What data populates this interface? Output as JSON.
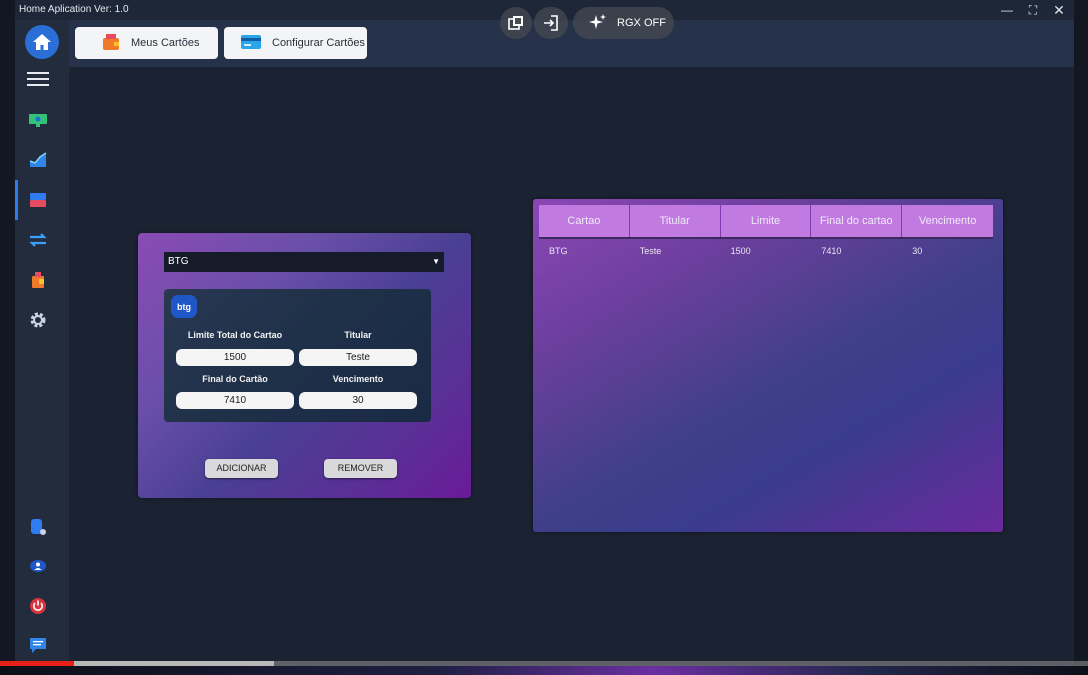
{
  "window": {
    "title": "Home Aplication Ver: 1.0",
    "minimize_icon": "minimize-icon",
    "maximize_icon": "maximize-icon",
    "close_icon": "close-icon"
  },
  "topbar": {
    "meus_cartoes_label": "Meus Cartões",
    "configurar_cartoes_label": "Configurar Cartões"
  },
  "overlay": {
    "rgx_label": "RGX OFF"
  },
  "sidebar": {
    "items": [
      {
        "icon": "home-icon"
      },
      {
        "icon": "menu-icon"
      },
      {
        "icon": "money-icon"
      },
      {
        "icon": "chart-icon"
      },
      {
        "icon": "card-icon"
      },
      {
        "icon": "transfer-icon"
      },
      {
        "icon": "wallet-icon"
      },
      {
        "icon": "gear-icon"
      },
      {
        "icon": "database-settings-icon"
      },
      {
        "icon": "user-icon"
      },
      {
        "icon": "power-icon"
      },
      {
        "icon": "chat-icon"
      }
    ]
  },
  "form": {
    "select_value": "BTG",
    "logo_text": "btg",
    "limite_label": "Limite Total do Cartao",
    "limite_value": "1500",
    "titular_label": "Titular",
    "titular_value": "Teste",
    "final_label": "Final do Cartão",
    "final_value": "7410",
    "vencimento_label": "Vencimento",
    "vencimento_value": "30",
    "add_button": "ADICIONAR",
    "remove_button": "REMOVER"
  },
  "table": {
    "headers": [
      "Cartao",
      "Titular",
      "Limite",
      "Final do cartao",
      "Vencimento"
    ],
    "rows": [
      [
        "BTG",
        "Teste",
        "1500",
        "7410",
        "30"
      ]
    ]
  },
  "video": {
    "played_fraction": 0.068,
    "buffered_fraction": 0.252
  },
  "colors": {
    "accent_blue": "#2b6fd6",
    "card_purple": "#8a4bb5",
    "header_purple": "#c07ae0",
    "progress_red": "#e62117"
  }
}
